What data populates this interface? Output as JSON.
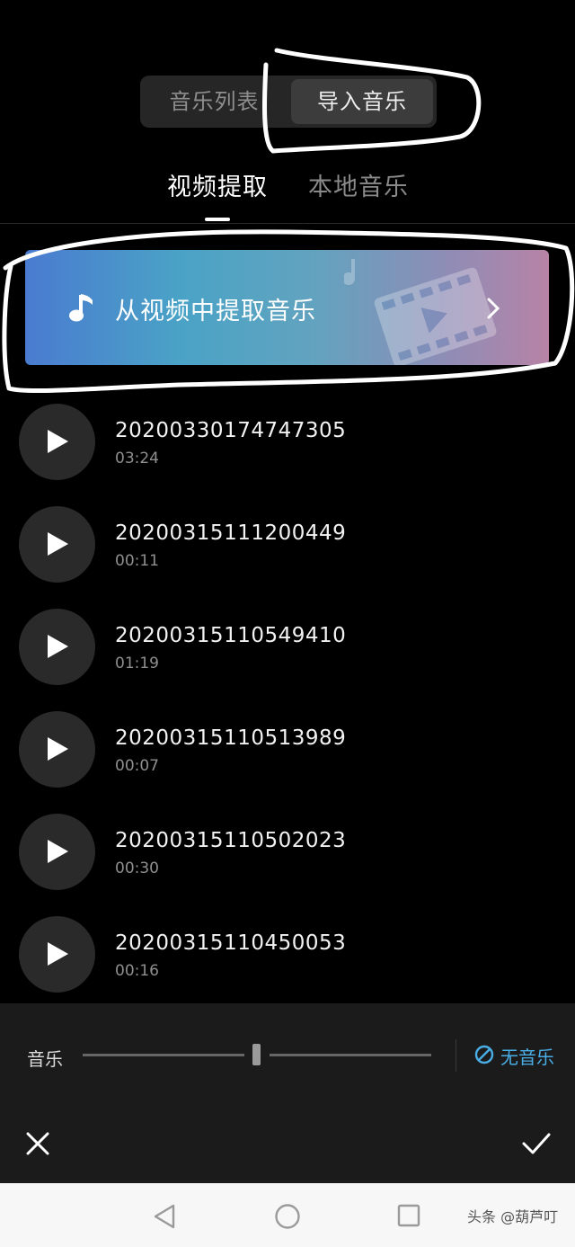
{
  "top_segment": {
    "options": [
      "音乐列表",
      "导入音乐"
    ],
    "selected_index": 1
  },
  "tabs": [
    {
      "label": "视频提取",
      "active": true
    },
    {
      "label": "本地音乐",
      "active": false
    }
  ],
  "banner": {
    "label": "从视频中提取音乐"
  },
  "tracks": [
    {
      "name": "20200330174747305",
      "duration": "03:24"
    },
    {
      "name": "20200315111200449",
      "duration": "00:11"
    },
    {
      "name": "20200315110549410",
      "duration": "01:19"
    },
    {
      "name": "20200315110513989",
      "duration": "00:07"
    },
    {
      "name": "20200315110502023",
      "duration": "00:30"
    },
    {
      "name": "20200315110450053",
      "duration": "00:16"
    }
  ],
  "bottom": {
    "volume_label": "音乐",
    "no_music_label": "无音乐",
    "accent_color": "#4aaee6",
    "volume_level": 0.5
  },
  "watermark": "头条 @葫芦叮"
}
